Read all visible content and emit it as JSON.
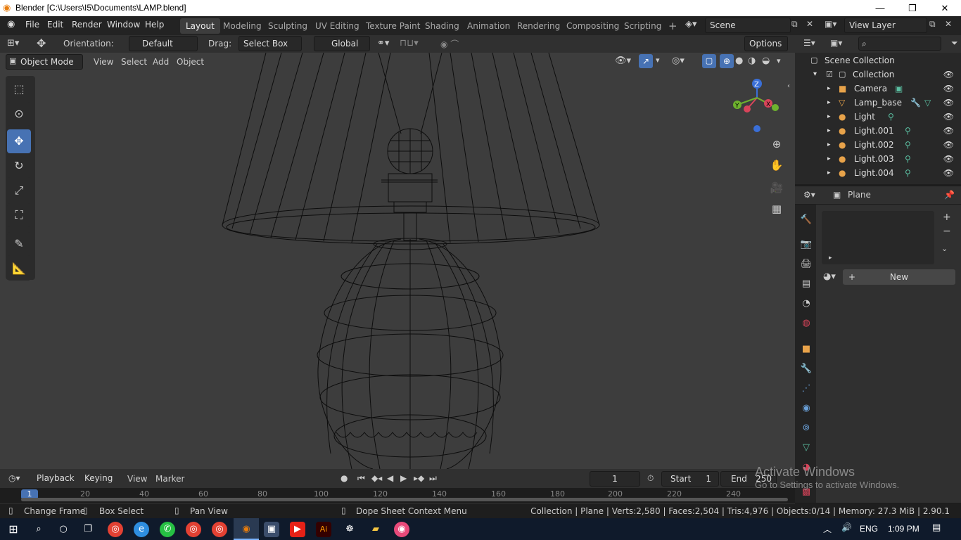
{
  "window": {
    "title": "Blender [C:\\Users\\I5\\Documents\\LAMP.blend]",
    "minimize": "—",
    "maximize": "❐",
    "close": "✕"
  },
  "menu": {
    "file": "File",
    "edit": "Edit",
    "render": "Render",
    "window": "Window",
    "help": "Help"
  },
  "workspaces": [
    "Layout",
    "Modeling",
    "Sculpting",
    "UV Editing",
    "Texture Paint",
    "Shading",
    "Animation",
    "Rendering",
    "Compositing",
    "Scripting"
  ],
  "scene": {
    "name": "Scene",
    "view_layer": "View Layer"
  },
  "toolheader": {
    "orientation_label": "Orientation:",
    "orientation_value": "Default",
    "drag_label": "Drag:",
    "drag_value": "Select Box",
    "transform": "Global",
    "options": "Options"
  },
  "viewport_header": {
    "mode": "Object Mode",
    "view": "View",
    "select": "Select",
    "add": "Add",
    "object": "Object"
  },
  "gizmo": {
    "z": "Z",
    "x": "X",
    "y": "Y"
  },
  "outliner": {
    "root": "Scene Collection",
    "collection": "Collection",
    "items": [
      "Camera",
      "Lamp_base",
      "Light",
      "Light.001",
      "Light.002",
      "Light.003",
      "Light.004"
    ]
  },
  "properties": {
    "object_name": "Plane",
    "new_button": "New"
  },
  "timeline": {
    "playback": "Playback",
    "keying": "Keying",
    "view": "View",
    "marker": "Marker",
    "current_frame": "1",
    "start_label": "Start",
    "start_value": "1",
    "end_label": "End",
    "end_value": "250",
    "ticks": [
      "1",
      "20",
      "40",
      "60",
      "80",
      "100",
      "120",
      "140",
      "160",
      "180",
      "200",
      "220",
      "240"
    ]
  },
  "statusbar": {
    "change_frame": "Change Frame",
    "box_select": "Box Select",
    "pan_view": "Pan View",
    "context_menu": "Dope Sheet Context Menu",
    "stats": "Collection | Plane | Verts:2,580 | Faces:2,504 | Tris:4,976 | Objects:0/14 | Memory: 27.3 MiB | 2.90.1"
  },
  "watermark": {
    "line1": "Activate Windows",
    "line2": "Go to Settings to activate Windows."
  },
  "taskbar": {
    "lang": "ENG",
    "time": "1:09 PM"
  },
  "colors": {
    "accent": "#4772b3",
    "viewport": "#3d3d3d",
    "header": "#303030"
  }
}
